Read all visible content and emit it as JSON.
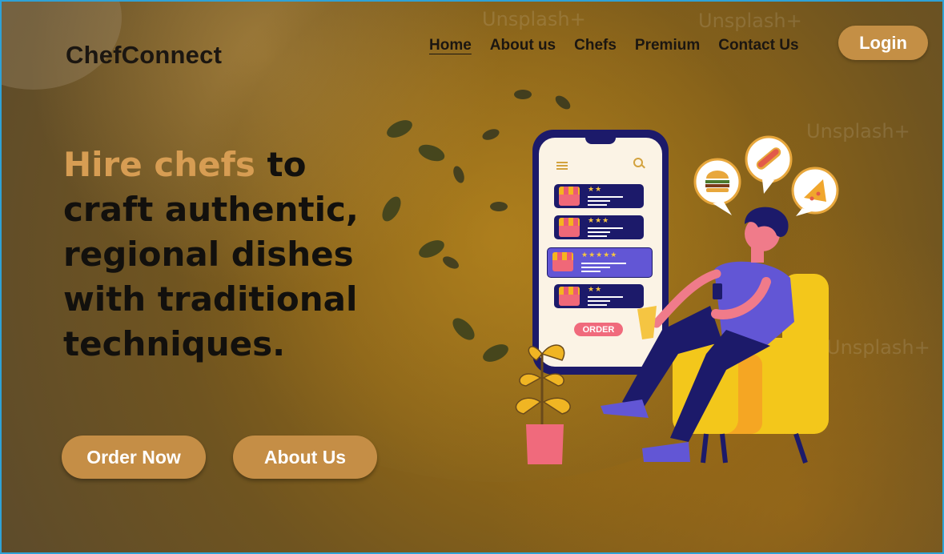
{
  "brand": {
    "name": "ChefConnect"
  },
  "nav": {
    "items": [
      {
        "label": "Home",
        "active": true
      },
      {
        "label": "About us"
      },
      {
        "label": "Chefs"
      },
      {
        "label": "Premium"
      },
      {
        "label": "Contact Us"
      }
    ]
  },
  "login": {
    "label": "Login"
  },
  "hero": {
    "highlight": "Hire chefs",
    "rest": " to craft authentic, regional dishes with traditional techniques."
  },
  "cta": {
    "order_label": "Order Now",
    "about_label": "About Us"
  },
  "illustration": {
    "order_label": "ORDER",
    "cards": [
      {
        "stars": "★★"
      },
      {
        "stars": "★★★"
      },
      {
        "stars": "★★★★★"
      },
      {
        "stars": "★★"
      }
    ]
  },
  "watermark": {
    "text": "Unsplash+"
  },
  "colors": {
    "accent": "#C58E46",
    "highlight_text": "#D79D53",
    "phone": "#1C1A6A",
    "chair": "#F3C71B"
  }
}
